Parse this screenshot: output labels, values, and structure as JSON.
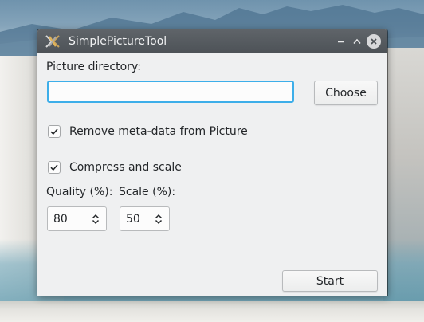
{
  "window": {
    "title": "SimplePictureTool",
    "minimize_icon": "minimize-icon",
    "maximize_icon": "maximize-icon",
    "close_icon": "close-icon"
  },
  "form": {
    "directory_label": "Picture directory:",
    "directory_value": "",
    "directory_placeholder": "",
    "choose_label": "Choose",
    "remove_meta_label": "Remove meta-data from Picture",
    "remove_meta_checked": true,
    "compress_label": "Compress and scale",
    "compress_checked": true,
    "quality_label": "Quality (%):",
    "quality_value": "80",
    "scale_label": "Scale (%):",
    "scale_value": "50",
    "start_label": "Start"
  },
  "colors": {
    "titlebar": "#4d5257",
    "window_bg": "#eff0f1",
    "focus_accent": "#3daee9",
    "text": "#232629"
  }
}
